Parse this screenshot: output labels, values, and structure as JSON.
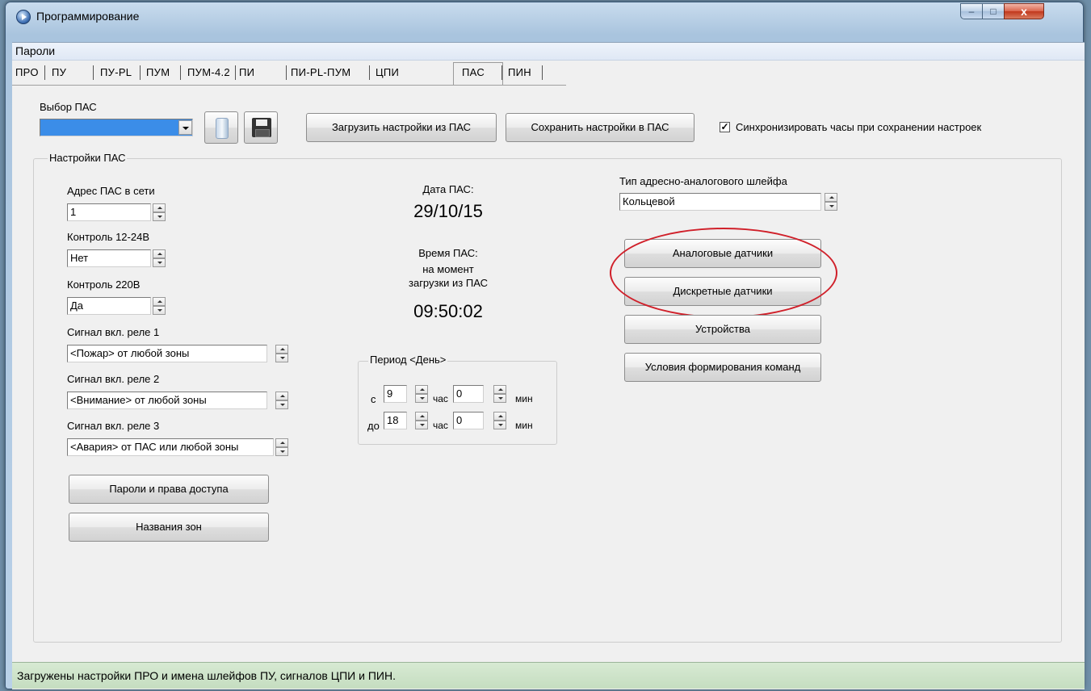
{
  "window": {
    "title": "Программирование",
    "controls": {
      "minimize": "–",
      "maximize": "□",
      "close": "x"
    }
  },
  "menu": {
    "items": [
      "Пароли"
    ]
  },
  "tabs": {
    "items": [
      "ПРО",
      "ПУ",
      "ПУ-PL",
      "ПУМ",
      "ПУМ-4.2",
      "ПИ",
      "ПИ-PL-ПУМ",
      "ЦПИ",
      "ПАС",
      "ПИН"
    ],
    "active": "ПАС"
  },
  "toolbar": {
    "select_label": "Выбор ПАС",
    "select_value": "",
    "load_button": "Загрузить  настройки из ПАС",
    "save_button": "Сохранить настройки в ПАС",
    "sync_checkbox": {
      "label": "Синхронизировать часы при сохранении настроек",
      "checked": true
    }
  },
  "settings": {
    "group_title": "Настройки ПАС",
    "address": {
      "label": "Адрес ПАС в сети",
      "value": "1"
    },
    "control_12_24": {
      "label": "Контроль 12-24В",
      "value": "Нет"
    },
    "control_220": {
      "label": "Контроль 220В",
      "value": "Да"
    },
    "relay1": {
      "label": "Сигнал вкл. реле 1",
      "value": "<Пожар> от любой зоны"
    },
    "relay2": {
      "label": "Сигнал вкл. реле 2",
      "value": "<Внимание> от любой зоны"
    },
    "relay3": {
      "label": "Сигнал вкл. реле 3",
      "value": "<Авария> от ПАС или любой зоны"
    },
    "passwords_button": "Пароли и права доступа",
    "zone_names_button": "Названия зон"
  },
  "clock": {
    "date_label": "Дата ПАС:",
    "date_value": "29/10/15",
    "time_label": "Время ПАС:",
    "time_note_1": "на момент",
    "time_note_2": "загрузки из ПАС",
    "time_value": "09:50:02"
  },
  "period": {
    "title": "Период <День>",
    "from_label": "с",
    "to_label": "до",
    "from_hour": "9",
    "from_min": "0",
    "to_hour": "18",
    "to_min": "0",
    "hour_unit": "час",
    "min_unit": "мин"
  },
  "loop": {
    "type_label": "Тип адресно-аналогового шлейфа",
    "type_value": "Кольцевой",
    "analog_button": "Аналоговые датчики",
    "discrete_button": "Дискретные датчики",
    "devices_button": "Устройства",
    "conditions_button": "Условия формирования команд",
    "highlight_color": "#d0202a"
  },
  "status": {
    "text": "Загружены настройки ПРО и имена шлейфов ПУ, сигналов ЦПИ и ПИН."
  }
}
